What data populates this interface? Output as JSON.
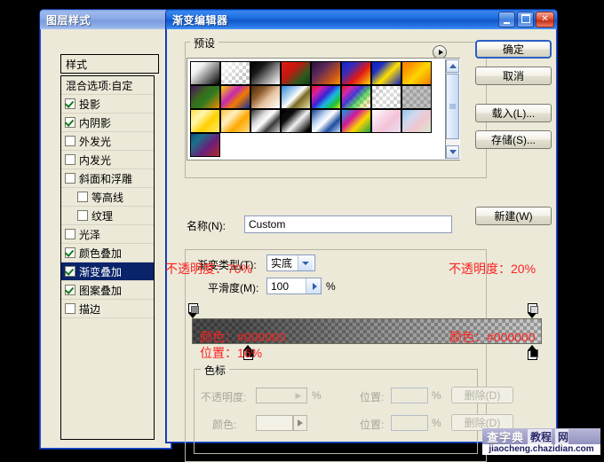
{
  "layer_style_dialog": {
    "title": "图层样式",
    "header": "样式",
    "blend_options": "混合选项:自定",
    "items": [
      {
        "label": "投影",
        "checked": true,
        "indent": false,
        "selected": false
      },
      {
        "label": "内阴影",
        "checked": true,
        "indent": false,
        "selected": false
      },
      {
        "label": "外发光",
        "checked": false,
        "indent": false,
        "selected": false
      },
      {
        "label": "内发光",
        "checked": false,
        "indent": false,
        "selected": false
      },
      {
        "label": "斜面和浮雕",
        "checked": false,
        "indent": false,
        "selected": false
      },
      {
        "label": "等高线",
        "checked": false,
        "indent": true,
        "selected": false
      },
      {
        "label": "纹理",
        "checked": false,
        "indent": true,
        "selected": false
      },
      {
        "label": "光泽",
        "checked": false,
        "indent": false,
        "selected": false
      },
      {
        "label": "颜色叠加",
        "checked": true,
        "indent": false,
        "selected": false
      },
      {
        "label": "渐变叠加",
        "checked": true,
        "indent": false,
        "selected": true
      },
      {
        "label": "图案叠加",
        "checked": true,
        "indent": false,
        "selected": false
      },
      {
        "label": "描边",
        "checked": false,
        "indent": false,
        "selected": false
      }
    ]
  },
  "gradient_editor_dialog": {
    "title": "渐变编辑器",
    "window_buttons": {
      "minimize": "minimize-icon",
      "maximize": "maximize-icon",
      "close": "close-icon"
    },
    "presets": {
      "group_label": "预设",
      "menu_icon": "preset-menu-arrow-icon",
      "swatches": [
        {
          "name": "foreground-to-background",
          "css": "linear-gradient(135deg,#ffffff 0%,#f2f2f2 28%,#8f8f8f 58%,#000000 100%)"
        },
        {
          "name": "foreground-to-transparent",
          "checker": true,
          "css": "linear-gradient(135deg,rgba(255,255,255,1) 0%,rgba(255,255,255,0.15) 70%,rgba(255,255,255,0) 100%)"
        },
        {
          "name": "black-white",
          "css": "linear-gradient(135deg,#000000 0%,#1a1a1a 30%,#8a8a8a 62%,#ffffff 100%)"
        },
        {
          "name": "red-green",
          "css": "linear-gradient(135deg,#e21b12 0%,#c01810 38%,#2d5a1e 72%,#123b14 100%)"
        },
        {
          "name": "violet-orange",
          "css": "linear-gradient(135deg,#2a1038 0%,#5d2a5a 35%,#c4531a 72%,#f59300 100%)"
        },
        {
          "name": "blue-red-yellow",
          "css": "linear-gradient(135deg,#1026cf 0%,#3a2bb9 28%,#e01717 60%,#ffd400 100%)"
        },
        {
          "name": "blue-yellow-blue",
          "css": "linear-gradient(135deg,#1020c8 0%,#2030c0 25%,#ffe000 55%,#1020c8 100%)"
        },
        {
          "name": "orange-yellow-orange",
          "css": "linear-gradient(135deg,#f57f00 0%,#ff9a00 25%,#ffd500 55%,#f07a00 100%)"
        },
        {
          "name": "violet-green-orange",
          "css": "linear-gradient(135deg,#4b1060 0%,#3a6a1c 38%,#2f7a20 58%,#f08a00 100%)"
        },
        {
          "name": "yellow-violet-orange-blue",
          "css": "linear-gradient(135deg,#ffd200 0%,#c42ab0 38%,#f07a00 62%,#10309c 100%)"
        },
        {
          "name": "copper",
          "css": "linear-gradient(135deg,#4a2a10 0%,#8b5a2b 30%,#e8c3a0 58%,#ffffff 100%)"
        },
        {
          "name": "chrome",
          "css": "linear-gradient(135deg,#2f86d4 0%,#bcd9f0 35%,#ffffff 48%,#7a6a22 64%,#e8e0a8 100%)"
        },
        {
          "name": "spectrum",
          "css": "linear-gradient(135deg,#e61717 0%,#d41fa8 22%,#3a22d8 44%,#19b9e0 62%,#1fc432 82%,#e6e617 100%)"
        },
        {
          "name": "transparent-rainbow",
          "checker": true,
          "css": "linear-gradient(135deg,rgba(230,23,23,1) 0%,rgba(212,31,168,.95) 20%,rgba(58,34,216,.9) 40%,rgba(31,196,50,.7) 62%,rgba(230,230,23,.35) 82%,rgba(255,255,255,0) 100%)"
        },
        {
          "name": "transparent-stripes",
          "checker": true,
          "css": "linear-gradient(135deg,rgba(255,255,255,0) 0%,rgba(250,250,250,.55) 50%,rgba(255,255,255,0) 100%)"
        },
        {
          "name": "neutral-density",
          "checker": true,
          "css": "linear-gradient(180deg,rgba(140,140,140,.55),rgba(140,140,140,.55))"
        },
        {
          "name": "yellow-pastel",
          "css": "linear-gradient(135deg,#ffe14a 0%,#fff7b0 30%,#ffd000 60%,#ffe966 100%)"
        },
        {
          "name": "orange-pastel",
          "css": "linear-gradient(135deg,#ffc23a 0%,#fff0c0 32%,#ffa800 62%,#ffdc80 100%)"
        },
        {
          "name": "silver",
          "css": "linear-gradient(135deg,#2d2d2d 0%,#d8d8d8 32%,#ffffff 48%,#3a3a3a 70%,#cfcfcf 100%)"
        },
        {
          "name": "black-white-soft",
          "css": "linear-gradient(135deg,#000000 0%,#0d0d0d 28%,#f2f2f2 55%,#000000 92%)"
        },
        {
          "name": "steel-blue",
          "css": "linear-gradient(135deg,#123a8a 0%,#bcd4f2 32%,#ffffff 48%,#1d4ea0 72%,#c6d9f4 100%)"
        },
        {
          "name": "cyan-magenta-green",
          "css": "linear-gradient(135deg,#00a8e8 0%,#d4179a 35%,#ffd400 62%,#1aa34a 100%)"
        },
        {
          "name": "pastel-pink",
          "css": "linear-gradient(135deg,#ffffff 0%,#f8d7e6 35%,#f3c2d6 60%,#eadff0 100%)"
        },
        {
          "name": "pastel-blue-pink",
          "css": "linear-gradient(135deg,#8fc8e8 0%,#cfd8ee 32%,#f0c6cf 60%,#d7e8cf 100%)"
        },
        {
          "name": "blue-green-violet",
          "css": "linear-gradient(135deg,#0d4f78 0%,#1b6f8a 25%,#6a1f7a 60%,#b02a2a 100%)"
        }
      ],
      "scrollbar": {
        "up": "scroll-up-icon",
        "down": "scroll-down-icon"
      }
    },
    "name_row": {
      "label": "名称(N):",
      "label_mnemonic": "N",
      "value": "Custom"
    },
    "gradient_type": {
      "label": "渐变类型(T):",
      "label_mnemonic": "T",
      "value": "实底"
    },
    "smoothness": {
      "label": "平滑度(M):",
      "label_mnemonic": "M",
      "value": "100",
      "unit": "%"
    },
    "stops_group": {
      "group_label": "色标",
      "opacity_label": "不透明度:",
      "opacity_value": "",
      "opacity_unit": "%",
      "color_label": "颜色:",
      "color_value": "",
      "location_label_1": "位置:",
      "location_value_1": "",
      "location_unit_1": "%",
      "location_label_2": "位置:",
      "location_value_2": "",
      "location_unit_2": "%",
      "delete_label_1": "删除(D)",
      "delete_label_2": "删除(D)"
    },
    "buttons": {
      "ok": "确定",
      "cancel": "取消",
      "load": "载入(L)...",
      "save": "存储(S)...",
      "new": "新建(W)"
    }
  },
  "annotations": {
    "opacity_left": "不透明度：70%",
    "opacity_right": "不透明度：20%",
    "color_left": "颜色：#000000",
    "color_right": "颜色：#000000",
    "position_left": "位置：16%",
    "accent_color": "#fb2222"
  },
  "watermark": {
    "brand": "查字典",
    "suffix_1": "教程",
    "suffix_2": "网",
    "url": "jiaocheng.chazidian.com"
  }
}
